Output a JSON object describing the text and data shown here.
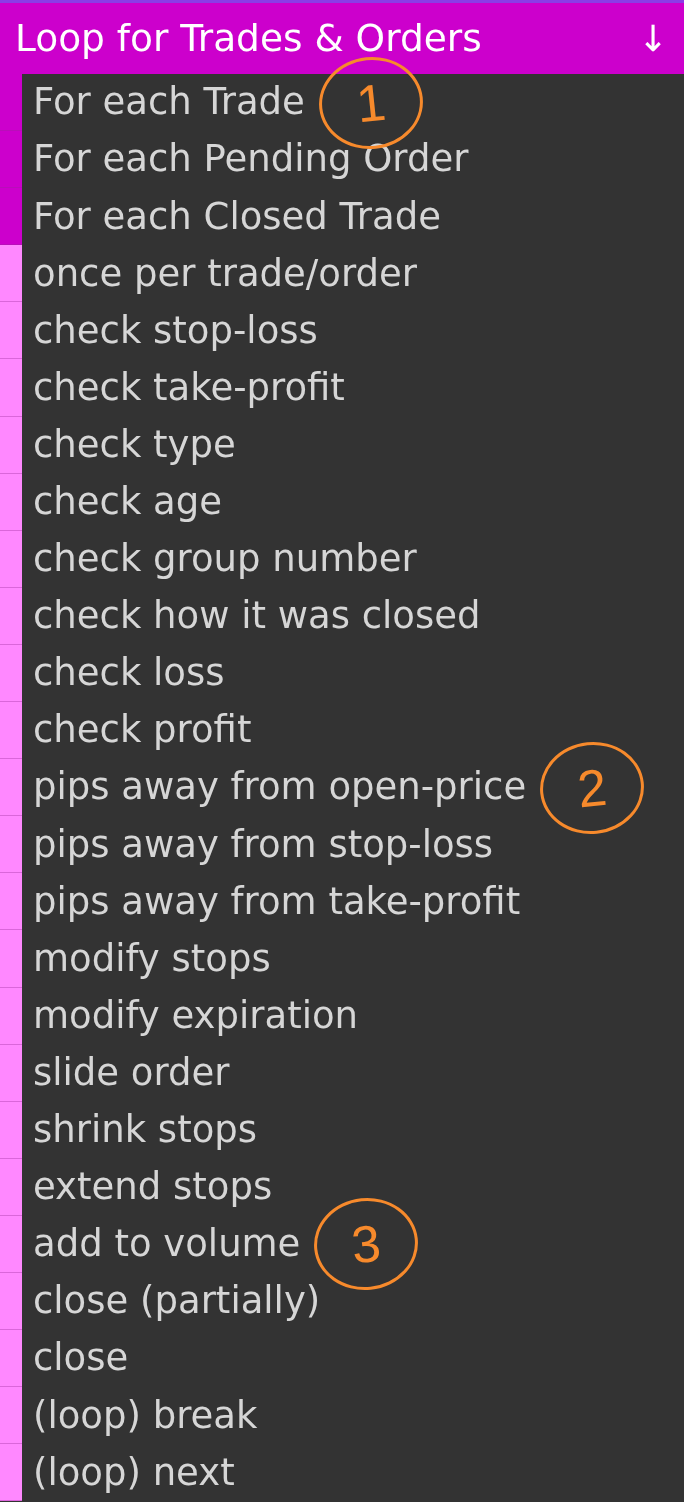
{
  "header": {
    "title": "Loop for Trades & Orders",
    "arrow": "↓"
  },
  "items": [
    {
      "label": "For each Trade",
      "color": "#cc00cc",
      "annotation": "1"
    },
    {
      "label": "For each Pending Order",
      "color": "#cc00cc"
    },
    {
      "label": "For each Closed Trade",
      "color": "#cc00cc"
    },
    {
      "label": "once per trade/order",
      "color": "#ff88ff"
    },
    {
      "label": "check stop-loss",
      "color": "#ff88ff"
    },
    {
      "label": "check take-profit",
      "color": "#ff88ff"
    },
    {
      "label": "check type",
      "color": "#ff88ff"
    },
    {
      "label": "check age",
      "color": "#ff88ff"
    },
    {
      "label": "check group number",
      "color": "#ff88ff"
    },
    {
      "label": "check how it was closed",
      "color": "#ff88ff"
    },
    {
      "label": "check loss",
      "color": "#ff88ff"
    },
    {
      "label": "check profit",
      "color": "#ff88ff"
    },
    {
      "label": "pips away from open-price",
      "color": "#ff88ff",
      "annotation": "2"
    },
    {
      "label": "pips away from stop-loss",
      "color": "#ff88ff"
    },
    {
      "label": "pips away from take-profit",
      "color": "#ff88ff"
    },
    {
      "label": "modify stops",
      "color": "#ff88ff"
    },
    {
      "label": "modify expiration",
      "color": "#ff88ff"
    },
    {
      "label": "slide order",
      "color": "#ff88ff"
    },
    {
      "label": "shrink stops",
      "color": "#ff88ff"
    },
    {
      "label": "extend stops",
      "color": "#ff88ff"
    },
    {
      "label": "add to volume",
      "color": "#ff88ff",
      "annotation": "3"
    },
    {
      "label": "close (partially)",
      "color": "#ff88ff"
    },
    {
      "label": "close",
      "color": "#ff88ff"
    },
    {
      "label": "(loop) break",
      "color": "#ff88ff"
    },
    {
      "label": "(loop) next",
      "color": "#ff88ff"
    }
  ]
}
